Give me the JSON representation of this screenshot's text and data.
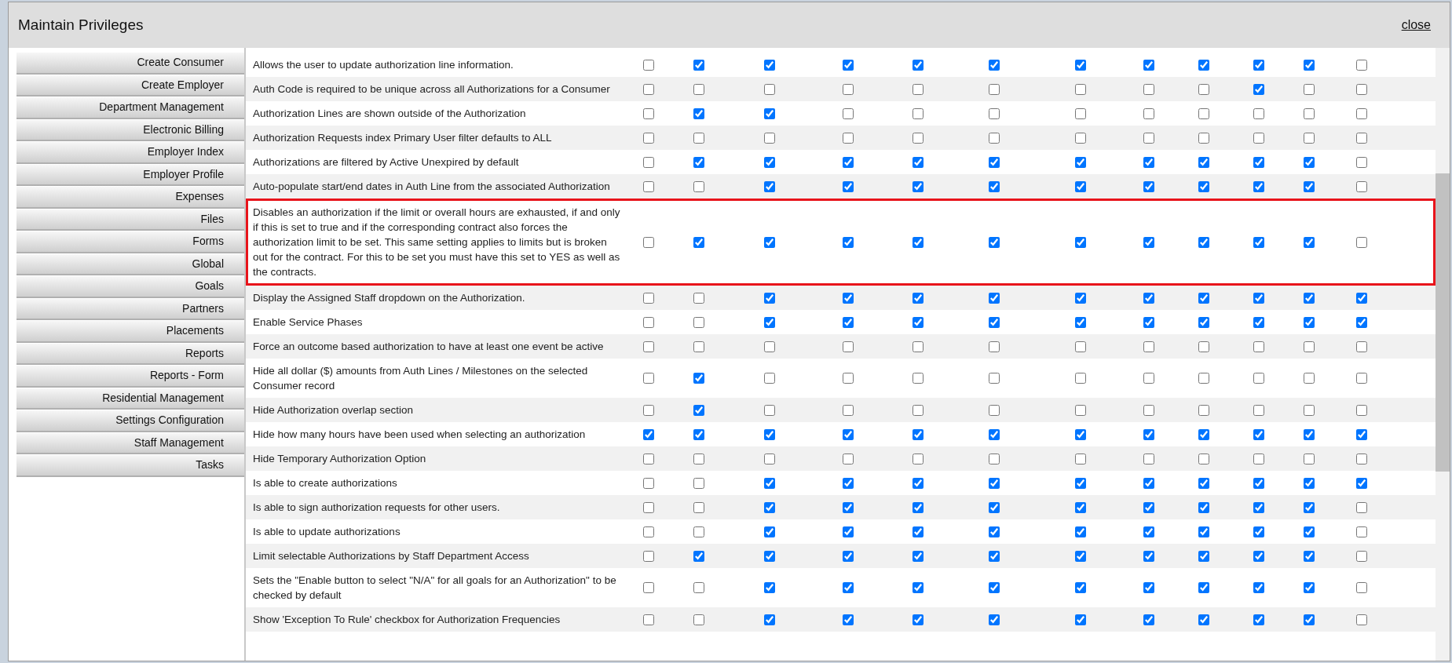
{
  "window": {
    "title": "Maintain Privileges",
    "close": "close"
  },
  "sidebar": {
    "items": [
      {
        "label": "Create Consumer"
      },
      {
        "label": "Create Employer"
      },
      {
        "label": "Department Management"
      },
      {
        "label": "Electronic Billing"
      },
      {
        "label": "Employer Index"
      },
      {
        "label": "Employer Profile"
      },
      {
        "label": "Expenses"
      },
      {
        "label": "Files"
      },
      {
        "label": "Forms"
      },
      {
        "label": "Global"
      },
      {
        "label": "Goals"
      },
      {
        "label": "Partners"
      },
      {
        "label": "Placements"
      },
      {
        "label": "Reports"
      },
      {
        "label": "Reports - Form"
      },
      {
        "label": "Residential Management"
      },
      {
        "label": "Settings Configuration"
      },
      {
        "label": "Staff Management"
      },
      {
        "label": "Tasks"
      }
    ]
  },
  "table": {
    "rows": [
      {
        "text": "Allows the user to update authorization line information.",
        "highlighted": false,
        "checked": [
          false,
          true,
          true,
          true,
          true,
          true,
          true,
          true,
          true,
          true,
          true,
          false
        ]
      },
      {
        "text": "Auth Code is required to be unique across all Authorizations for a Consumer",
        "highlighted": false,
        "checked": [
          false,
          false,
          false,
          false,
          false,
          false,
          false,
          false,
          false,
          true,
          false,
          false
        ]
      },
      {
        "text": "Authorization Lines are shown outside of the Authorization",
        "highlighted": false,
        "checked": [
          false,
          true,
          true,
          false,
          false,
          false,
          false,
          false,
          false,
          false,
          false,
          false
        ]
      },
      {
        "text": "Authorization Requests index Primary User filter defaults to ALL",
        "highlighted": false,
        "checked": [
          false,
          false,
          false,
          false,
          false,
          false,
          false,
          false,
          false,
          false,
          false,
          false
        ]
      },
      {
        "text": "Authorizations are filtered by Active Unexpired by default",
        "highlighted": false,
        "checked": [
          false,
          true,
          true,
          true,
          true,
          true,
          true,
          true,
          true,
          true,
          true,
          false
        ]
      },
      {
        "text": "Auto-populate start/end dates in Auth Line from the associated Authorization",
        "highlighted": false,
        "checked": [
          false,
          false,
          true,
          true,
          true,
          true,
          true,
          true,
          true,
          true,
          true,
          false
        ]
      },
      {
        "text": "Disables an authorization if the limit or overall hours are exhausted, if and only if this is set to true and if the corresponding contract also forces the authorization limit to be set. This same setting applies to limits but is broken out for the contract. For this to be set you must have this set to YES as well as the contracts.",
        "highlighted": true,
        "checked": [
          false,
          true,
          true,
          true,
          true,
          true,
          true,
          true,
          true,
          true,
          true,
          false
        ]
      },
      {
        "text": "Display the Assigned Staff dropdown on the Authorization.",
        "highlighted": false,
        "checked": [
          false,
          false,
          true,
          true,
          true,
          true,
          true,
          true,
          true,
          true,
          true,
          true
        ]
      },
      {
        "text": "Enable Service Phases",
        "highlighted": false,
        "checked": [
          false,
          false,
          true,
          true,
          true,
          true,
          true,
          true,
          true,
          true,
          true,
          true
        ]
      },
      {
        "text": "Force an outcome based authorization to have at least one event be active",
        "highlighted": false,
        "checked": [
          false,
          false,
          false,
          false,
          false,
          false,
          false,
          false,
          false,
          false,
          false,
          false
        ]
      },
      {
        "text": "Hide all dollar ($) amounts from Auth Lines / Milestones on the selected Consumer record",
        "highlighted": false,
        "checked": [
          false,
          true,
          false,
          false,
          false,
          false,
          false,
          false,
          false,
          false,
          false,
          false
        ]
      },
      {
        "text": "Hide Authorization overlap section",
        "highlighted": false,
        "checked": [
          false,
          true,
          false,
          false,
          false,
          false,
          false,
          false,
          false,
          false,
          false,
          false
        ]
      },
      {
        "text": "Hide how many hours have been used when selecting an authorization",
        "highlighted": false,
        "checked": [
          true,
          true,
          true,
          true,
          true,
          true,
          true,
          true,
          true,
          true,
          true,
          true
        ]
      },
      {
        "text": "Hide Temporary Authorization Option",
        "highlighted": false,
        "checked": [
          false,
          false,
          false,
          false,
          false,
          false,
          false,
          false,
          false,
          false,
          false,
          false
        ]
      },
      {
        "text": "Is able to create authorizations",
        "highlighted": false,
        "checked": [
          false,
          false,
          true,
          true,
          true,
          true,
          true,
          true,
          true,
          true,
          true,
          true
        ]
      },
      {
        "text": "Is able to sign authorization requests for other users.",
        "highlighted": false,
        "checked": [
          false,
          false,
          true,
          true,
          true,
          true,
          true,
          true,
          true,
          true,
          true,
          false
        ]
      },
      {
        "text": "Is able to update authorizations",
        "highlighted": false,
        "checked": [
          false,
          false,
          true,
          true,
          true,
          true,
          true,
          true,
          true,
          true,
          true,
          false
        ]
      },
      {
        "text": "Limit selectable Authorizations by Staff Department Access",
        "highlighted": false,
        "checked": [
          false,
          true,
          true,
          true,
          true,
          true,
          true,
          true,
          true,
          true,
          true,
          false
        ]
      },
      {
        "text": "Sets the \"Enable button to select \"N/A\" for all goals for an Authorization\" to be checked by default",
        "highlighted": false,
        "checked": [
          false,
          false,
          true,
          true,
          true,
          true,
          true,
          true,
          true,
          true,
          true,
          false
        ]
      },
      {
        "text": "Show 'Exception To Rule' checkbox for Authorization Frequencies",
        "highlighted": false,
        "checked": [
          false,
          false,
          true,
          true,
          true,
          true,
          true,
          true,
          true,
          true,
          true,
          false
        ]
      }
    ]
  }
}
